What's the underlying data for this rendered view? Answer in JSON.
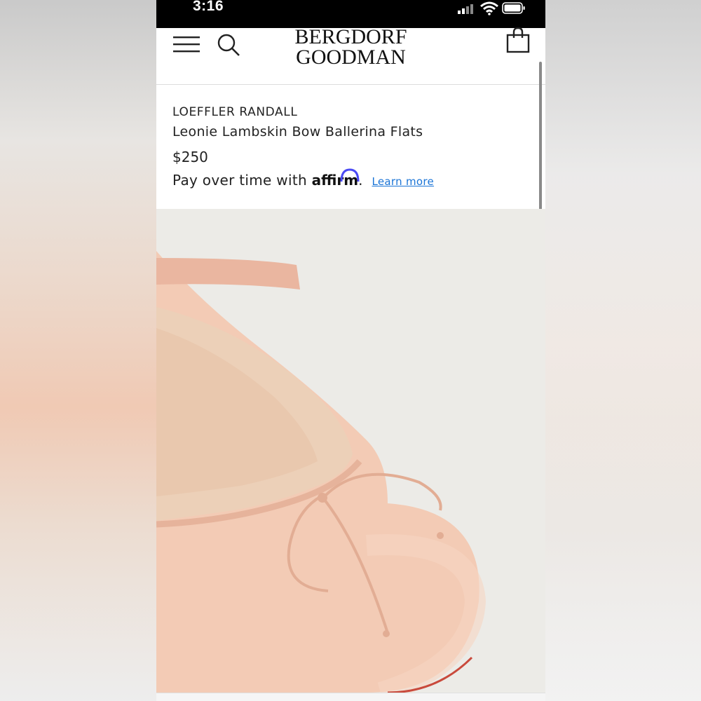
{
  "status_bar": {
    "time": "3:16"
  },
  "header": {
    "logo_line1": "BERGDORF",
    "logo_line2": "GOODMAN",
    "menu_icon": "hamburger-menu-icon",
    "search_icon": "search-icon",
    "bag_icon": "shopping-bag-icon"
  },
  "product": {
    "brand": "LOEFFLER RANDALL",
    "name": "Leonie Lambskin Bow Ballerina Flats",
    "price": "$250",
    "pay_prefix": "Pay over time with",
    "affirm_brand": "affirm",
    "pay_suffix": ".",
    "learn_more": "Learn more"
  },
  "colors": {
    "link": "#1a74d6",
    "affirm_arc": "#4a4af4",
    "shoe": "#f2c9b3"
  }
}
